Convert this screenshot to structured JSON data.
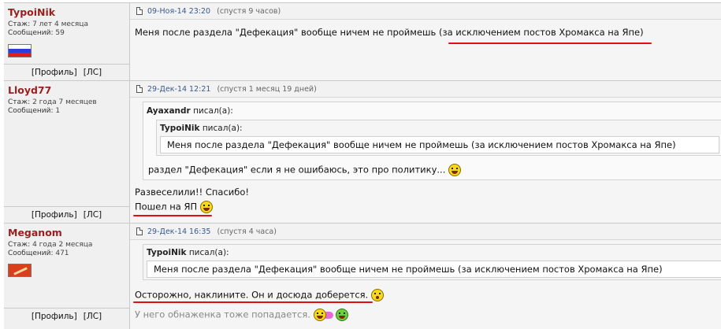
{
  "posts": [
    {
      "username": "TypoiNik",
      "stazh_label": "Стаж:",
      "stazh_value": "7 лет 4 месяца",
      "messages_label": "Сообщений:",
      "messages_value": "59",
      "profile_link": "[Профиль]",
      "pm_link": "[ЛС]",
      "date": "09-Ноя-14 23:20",
      "after": "(спустя 9 часов)",
      "text": "Меня после раздела \"Дефекация\" вообще ничем не проймешь (за исключением постов Хромакса на Япе)"
    },
    {
      "username": "Lloyd77",
      "stazh_label": "Стаж:",
      "stazh_value": "2 года 7 месяцев",
      "messages_label": "Сообщений:",
      "messages_value": "1",
      "profile_link": "[Профиль]",
      "pm_link": "[ЛС]",
      "date": "29-Дек-14 12:21",
      "after": "(спустя 1 месяц 19 дней)",
      "outer_quote_author": "Ayaxandr",
      "outer_quote_suffix": "писал(а):",
      "inner_quote_author": "TypoiNik",
      "inner_quote_suffix": "писал(а):",
      "inner_quote_text": "Меня после раздела \"Дефекация\" вообще ничем не проймешь (за исключением постов Хромакса на Япе)",
      "outer_quote_text": "раздел \"Дефекация\" если я не ошибаюсь, это про политику...",
      "line1": "Развеселили!! Спасибо!",
      "line2": "Пошел на ЯП"
    },
    {
      "username": "Meganom",
      "stazh_label": "Стаж:",
      "stazh_value": "4 года 2 месяца",
      "messages_label": "Сообщений:",
      "messages_value": "471",
      "profile_link": "[Профиль]",
      "pm_link": "[ЛС]",
      "date": "29-Дек-14 16:35",
      "after": "(спустя 4 часа)",
      "quote_author": "TypoiNik",
      "quote_suffix": "писал(а):",
      "quote_text": "Меня после раздела \"Дефекация\" вообще ничем не проймешь (за исключением постов Хромакса на Япе)",
      "line1": "Осторожно, наклините. Он и досюда доберется.",
      "line2": "У него обнаженка тоже попадается."
    }
  ],
  "colors": {
    "username": "#9a1f1f",
    "date_link": "#3a5a8c",
    "red_underline": "#e01010"
  }
}
